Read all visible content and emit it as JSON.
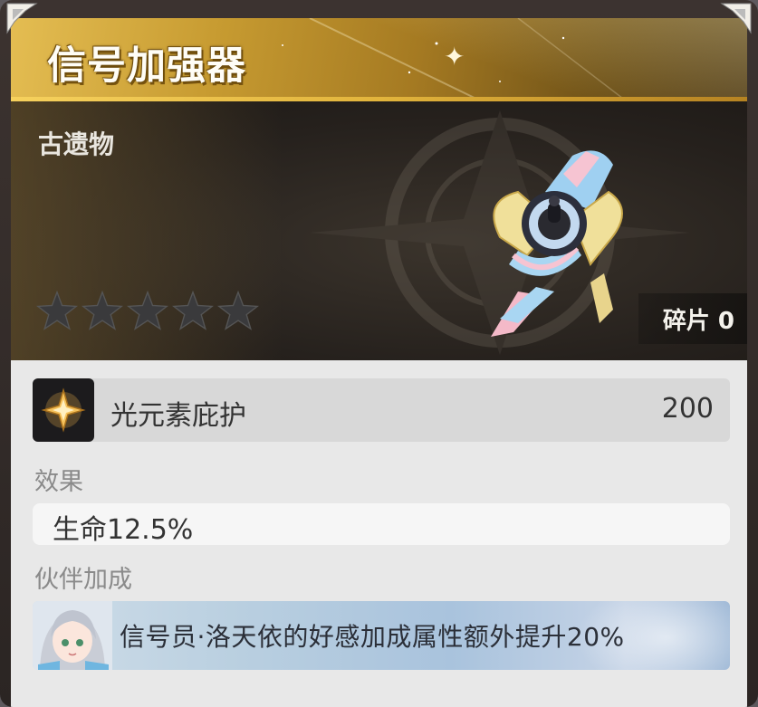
{
  "relic": {
    "title": "信号加强器",
    "category": "古遗物",
    "rarity_stars": 0,
    "rarity_max": 5,
    "fragments_label": "碎片 0"
  },
  "element": {
    "name": "光元素庇护",
    "value": "200",
    "icon": "light-element-icon"
  },
  "effect": {
    "label": "效果",
    "text": "生命12.5%"
  },
  "partner": {
    "label": "伙伴加成",
    "text": "信号员·洛天依的好感加成属性额外提升20%",
    "avatar": "partner-avatar"
  },
  "colors": {
    "header_gold": "#c79b31",
    "panel_bg": "#e8e8e8",
    "star_inactive": "#3a3a3c"
  }
}
